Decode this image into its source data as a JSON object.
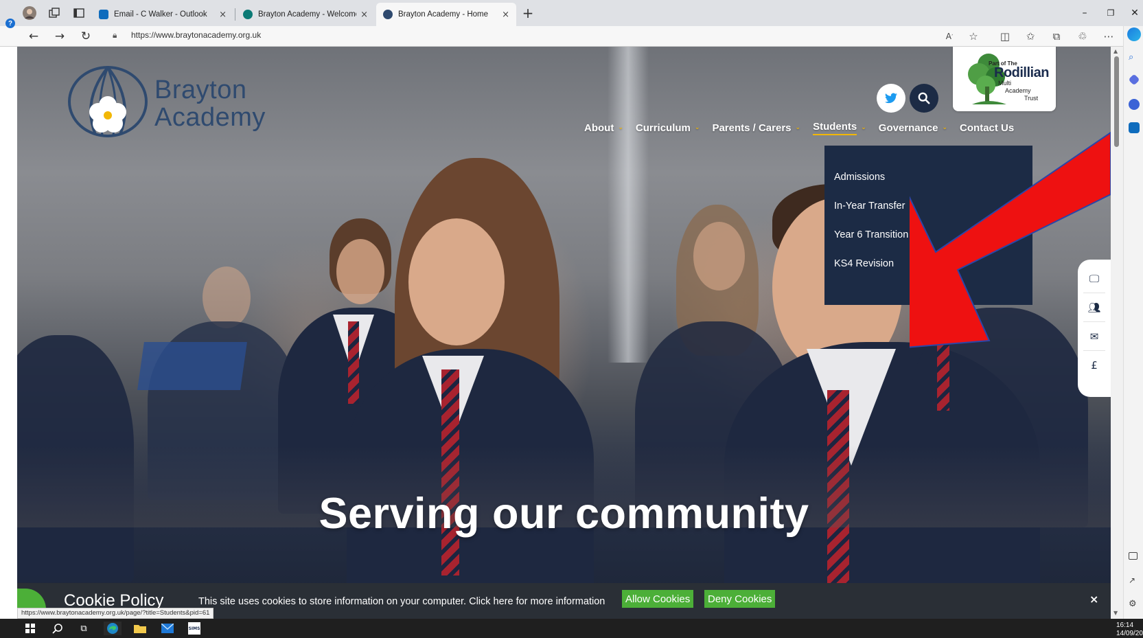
{
  "browser": {
    "tabs": [
      {
        "label": "Email - C Walker - Outlook",
        "active": false,
        "favicon_color": "#0f6cbd"
      },
      {
        "label": "Brayton Academy - Welcome",
        "active": false,
        "favicon_color": "#0b7a75"
      },
      {
        "label": "Brayton Academy - Home",
        "active": true,
        "favicon_color": "#2f4a6f"
      }
    ],
    "tab_close_glyph": "×",
    "new_tab_glyph": "+",
    "window_controls": {
      "minimize": "–",
      "restore": "❐",
      "close": "✕"
    },
    "url": "https://www.braytonacademy.org.uk",
    "status_url": "https://www.braytonacademy.org.uk/page/?title=Students&pid=61",
    "nav_icons": [
      "back-icon",
      "forward-icon",
      "refresh-icon",
      "lock-icon"
    ],
    "toolbar_icons": [
      "read-aloud-icon",
      "favorite-star-icon",
      "split-screen-icon",
      "favorites-icon",
      "collections-icon",
      "extensions-icon",
      "more-icon",
      "copilot-icon"
    ]
  },
  "site": {
    "logo_line1": "Brayton",
    "logo_line2": "Academy",
    "trust": {
      "line1": "Part of The",
      "line2": "Rodillian",
      "line3": "Multi",
      "line4": "Academy",
      "line5": "Trust"
    },
    "nav": [
      {
        "label": "About",
        "has_dropdown": true
      },
      {
        "label": "Curriculum",
        "has_dropdown": true
      },
      {
        "label": "Parents / Carers",
        "has_dropdown": true
      },
      {
        "label": "Students",
        "has_dropdown": true,
        "active": true
      },
      {
        "label": "Governance",
        "has_dropdown": true
      },
      {
        "label": "Contact Us",
        "has_dropdown": false
      }
    ],
    "students_menu": [
      "Admissions",
      "In-Year Transfer",
      "Year 6 Transition",
      "KS4 Revision"
    ],
    "side_icons": [
      "monitor-icon",
      "people-icon",
      "mail-icon",
      "pound-icon"
    ],
    "pound_glyph": "£",
    "hero_title": "Serving our community",
    "cookie": {
      "title": "Cookie Policy",
      "text": "This site uses cookies to store information on your computer. Click here for more information",
      "allow": "Allow Cookies",
      "deny": "Deny Cookies",
      "close": "×"
    },
    "colors": {
      "navy": "#1c2b45",
      "accent_gold": "#f2b705",
      "cookie_green": "#4caf38",
      "arrow_red": "#ee1111"
    }
  },
  "taskbar": {
    "time": "16:14",
    "date": "14/09/20",
    "icons": [
      "windows-start-icon",
      "search-icon",
      "task-view-icon",
      "edge-icon",
      "file-explorer-icon",
      "mail-icon",
      "sims-icon"
    ],
    "sims_label": "SIMS"
  }
}
